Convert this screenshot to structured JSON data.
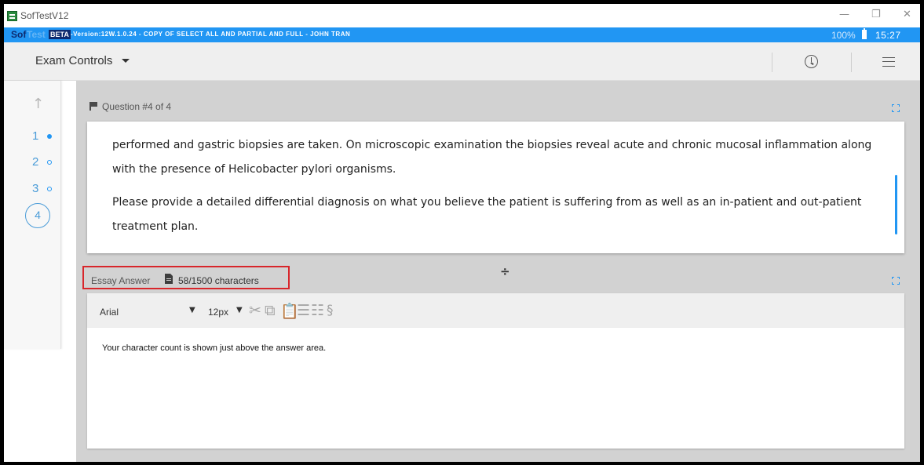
{
  "window": {
    "title": "SofTestV12",
    "controls": {
      "minimize": "—",
      "maximize": "❐",
      "close": "✕"
    }
  },
  "infobar": {
    "brand_sof": "Sof",
    "brand_test": "Test",
    "beta": "BETA",
    "version": "-Version:12W.1.0.24 - COPY OF SELECT ALL AND PARTIAL AND FULL - JOHN TRAN",
    "battery_pct": "100%",
    "time": "15:27"
  },
  "toolbar": {
    "exam_controls": "Exam Controls",
    "icons": [
      "clock-icon",
      "menu-icon"
    ]
  },
  "nav": {
    "up_arrow": "↑",
    "questions": [
      {
        "label": "1",
        "status": "answered"
      },
      {
        "label": "2",
        "status": "unanswered"
      },
      {
        "label": "3",
        "status": "unanswered"
      },
      {
        "label": "4",
        "status": "current"
      }
    ]
  },
  "question": {
    "header": "Question #4 of 4",
    "paragraphs": [
      "performed and gastric biopsies are taken. On microscopic examination the biopsies reveal acute and chronic mucosal inflammation along with the presence of Helicobacter pylori organisms.",
      "Please provide a detailed differential diagnosis on what you believe the patient is suffering from as well as an in-patient and out-patient treatment plan."
    ]
  },
  "splitter": {
    "glyph": "÷"
  },
  "essay": {
    "label": "Essay Answer",
    "char_count": "58/1500 characters",
    "font": "Arial",
    "size": "12px",
    "caret": "▼",
    "tools": {
      "cut": "✂",
      "copy": "⧉",
      "paste": "📋",
      "bullet_list": "☰",
      "number_list": "☷",
      "special_char": "§"
    },
    "answer_text": "Your character count is shown just above the answer area."
  },
  "colors": {
    "accent": "#2196f3",
    "highlight_box": "#d8262b",
    "content_bg": "#d2d2d2"
  }
}
